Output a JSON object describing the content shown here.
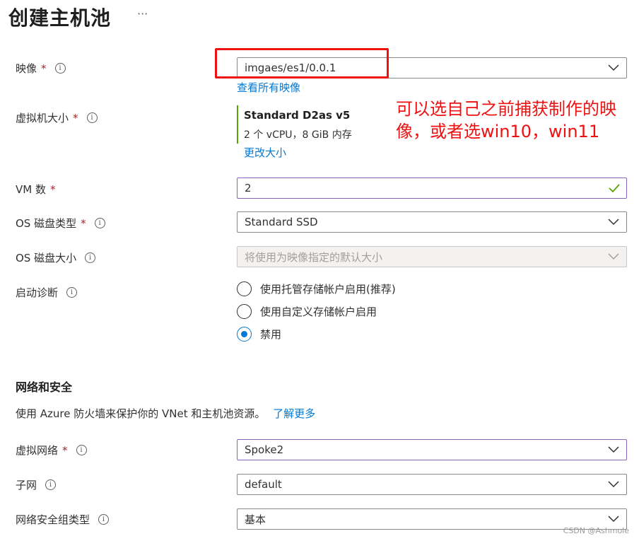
{
  "header": {
    "title": "创建主机池",
    "more": "···"
  },
  "fields": {
    "image": {
      "label": "映像",
      "required": "*",
      "value": "imgaes/es1/0.0.1",
      "link": "查看所有映像"
    },
    "vm_size": {
      "label": "虚拟机大小",
      "required": "*",
      "name": "Standard D2as v5",
      "spec": "2 个 vCPU，8 GiB 内存",
      "link": "更改大小"
    },
    "vm_count": {
      "label": "VM 数",
      "required": "*",
      "value": "2"
    },
    "os_disk_type": {
      "label": "OS 磁盘类型",
      "required": "*",
      "value": "Standard SSD"
    },
    "os_disk_size": {
      "label": "OS 磁盘大小",
      "placeholder": "将使用为映像指定的默认大小"
    },
    "boot_diag": {
      "label": "启动诊断",
      "options": [
        "使用托管存储帐户启用(推荐)",
        "使用自定义存储帐户启用",
        "禁用"
      ],
      "selected": "禁用"
    }
  },
  "network": {
    "title": "网络和安全",
    "desc": "使用 Azure 防火墙来保护你的 VNet 和主机池资源。",
    "learn_more": "了解更多",
    "vnet": {
      "label": "虚拟网络",
      "required": "*",
      "value": "Spoke2"
    },
    "subnet": {
      "label": "子网",
      "value": "default"
    },
    "nsg_type": {
      "label": "网络安全组类型",
      "value": "基本"
    }
  },
  "annotation": {
    "text": "可以选自己之前捕获制作的映像，或者选win10，win11"
  },
  "watermark": "CSDN @Ashmole",
  "colors": {
    "accent": "#0078d4",
    "annotation": "#ee1111",
    "valid": "#57a300",
    "focus": "#8764b8"
  }
}
